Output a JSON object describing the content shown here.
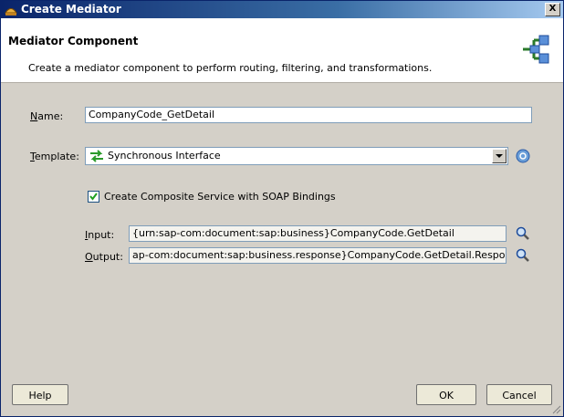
{
  "window": {
    "title": "Create Mediator",
    "close_label": "X"
  },
  "header": {
    "title": "Mediator Component",
    "description": "Create a mediator component to perform routing, filtering, and transformations."
  },
  "form": {
    "name": {
      "label_mnemonic": "N",
      "label_rest": "ame:",
      "value": "CompanyCode_GetDetail"
    },
    "template": {
      "label_mnemonic": "T",
      "label_rest": "emplate:",
      "value": "Synchronous Interface"
    },
    "create_composite": {
      "label_before": "Create Composite Service with SOAP Bindings",
      "checked": true
    },
    "input": {
      "label_mnemonic": "I",
      "label_rest": "nput:",
      "value": "{urn:sap-com:document:sap:business}CompanyCode.GetDetail"
    },
    "output": {
      "label_mnemonic": "O",
      "label_rest": "utput:",
      "value": "ap-com:document:sap:business.response}CompanyCode.GetDetail.Response"
    }
  },
  "buttons": {
    "help": "Help",
    "ok": "OK",
    "cancel": "Cancel"
  }
}
